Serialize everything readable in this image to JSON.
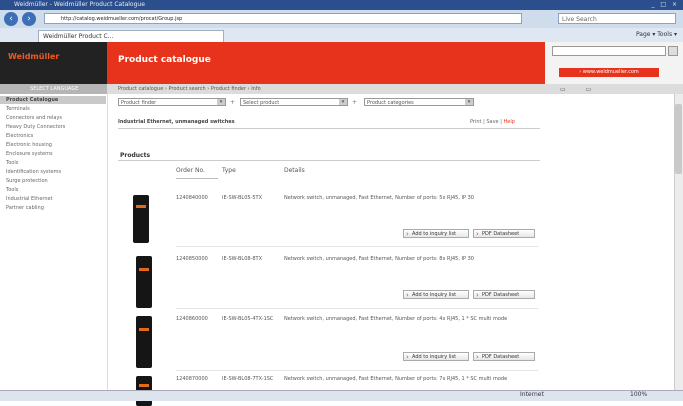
{
  "window": {
    "title": "Weidmüller - Weidmüller Product Catalogue",
    "controls": "_ □ ×"
  },
  "browser": {
    "address": "http://catalog.weidmueller.com/procat/Group.jsp",
    "search_placeholder": "Live Search",
    "tab_label": "Weidmüller Product C...",
    "tools": "Page ▾  Tools ▾"
  },
  "header": {
    "logo": "Weidmüller",
    "title": "Product catalogue",
    "site_link": "› www.weidmueller.com"
  },
  "breadcrumb": "Product catalogue › Product search › Product finder › Info",
  "sidebar": {
    "head": "SELECT LANGUAGE",
    "title": "Product Catalogue",
    "items": [
      "Terminals",
      "Connectors and relays",
      "Heavy Duty Connectors",
      "Electronics",
      "Electronic housing",
      "Enclosure systems",
      "Tools",
      "Identification systems",
      "Surge protection",
      "Tools",
      "Industrial Ethernet",
      "Partner cabling"
    ]
  },
  "filters": [
    "Product finder",
    "Select product",
    "Product categories"
  ],
  "options": {
    "label": "Industrial Ethernet, unmanaged switches",
    "links": "Print | Save | ",
    "links_red": "Help"
  },
  "products": {
    "heading": "Products",
    "columns": [
      "Order No.",
      "Type",
      "Details"
    ],
    "rows": [
      {
        "order": "1240840000",
        "type": "IE-SW-BL05-5TX",
        "details": "Network switch, unmanaged, Fast Ethernet, Number of ports: 5x RJ45, IP 30"
      },
      {
        "order": "1240850000",
        "type": "IE-SW-BL08-8TX",
        "details": "Network switch, unmanaged, Fast Ethernet, Number of ports: 8x RJ45, IP 30"
      },
      {
        "order": "1240860000",
        "type": "IE-SW-BL05-4TX-1SC",
        "details": "Network switch, unmanaged, Fast Ethernet, Number of ports: 4x RJ45, 1 * SC multi mode"
      },
      {
        "order": "1240870000",
        "type": "IE-SW-BL08-7TX-1SC",
        "details": "Network switch, unmanaged, Fast Ethernet, Number of ports: 7x RJ45, 1 * SC multi mode"
      }
    ],
    "btn_inquiry": "Add to inquiry list",
    "btn_pdf": "PDF Datasheet"
  },
  "status": {
    "zone": "Internet",
    "zoom": "100%"
  }
}
